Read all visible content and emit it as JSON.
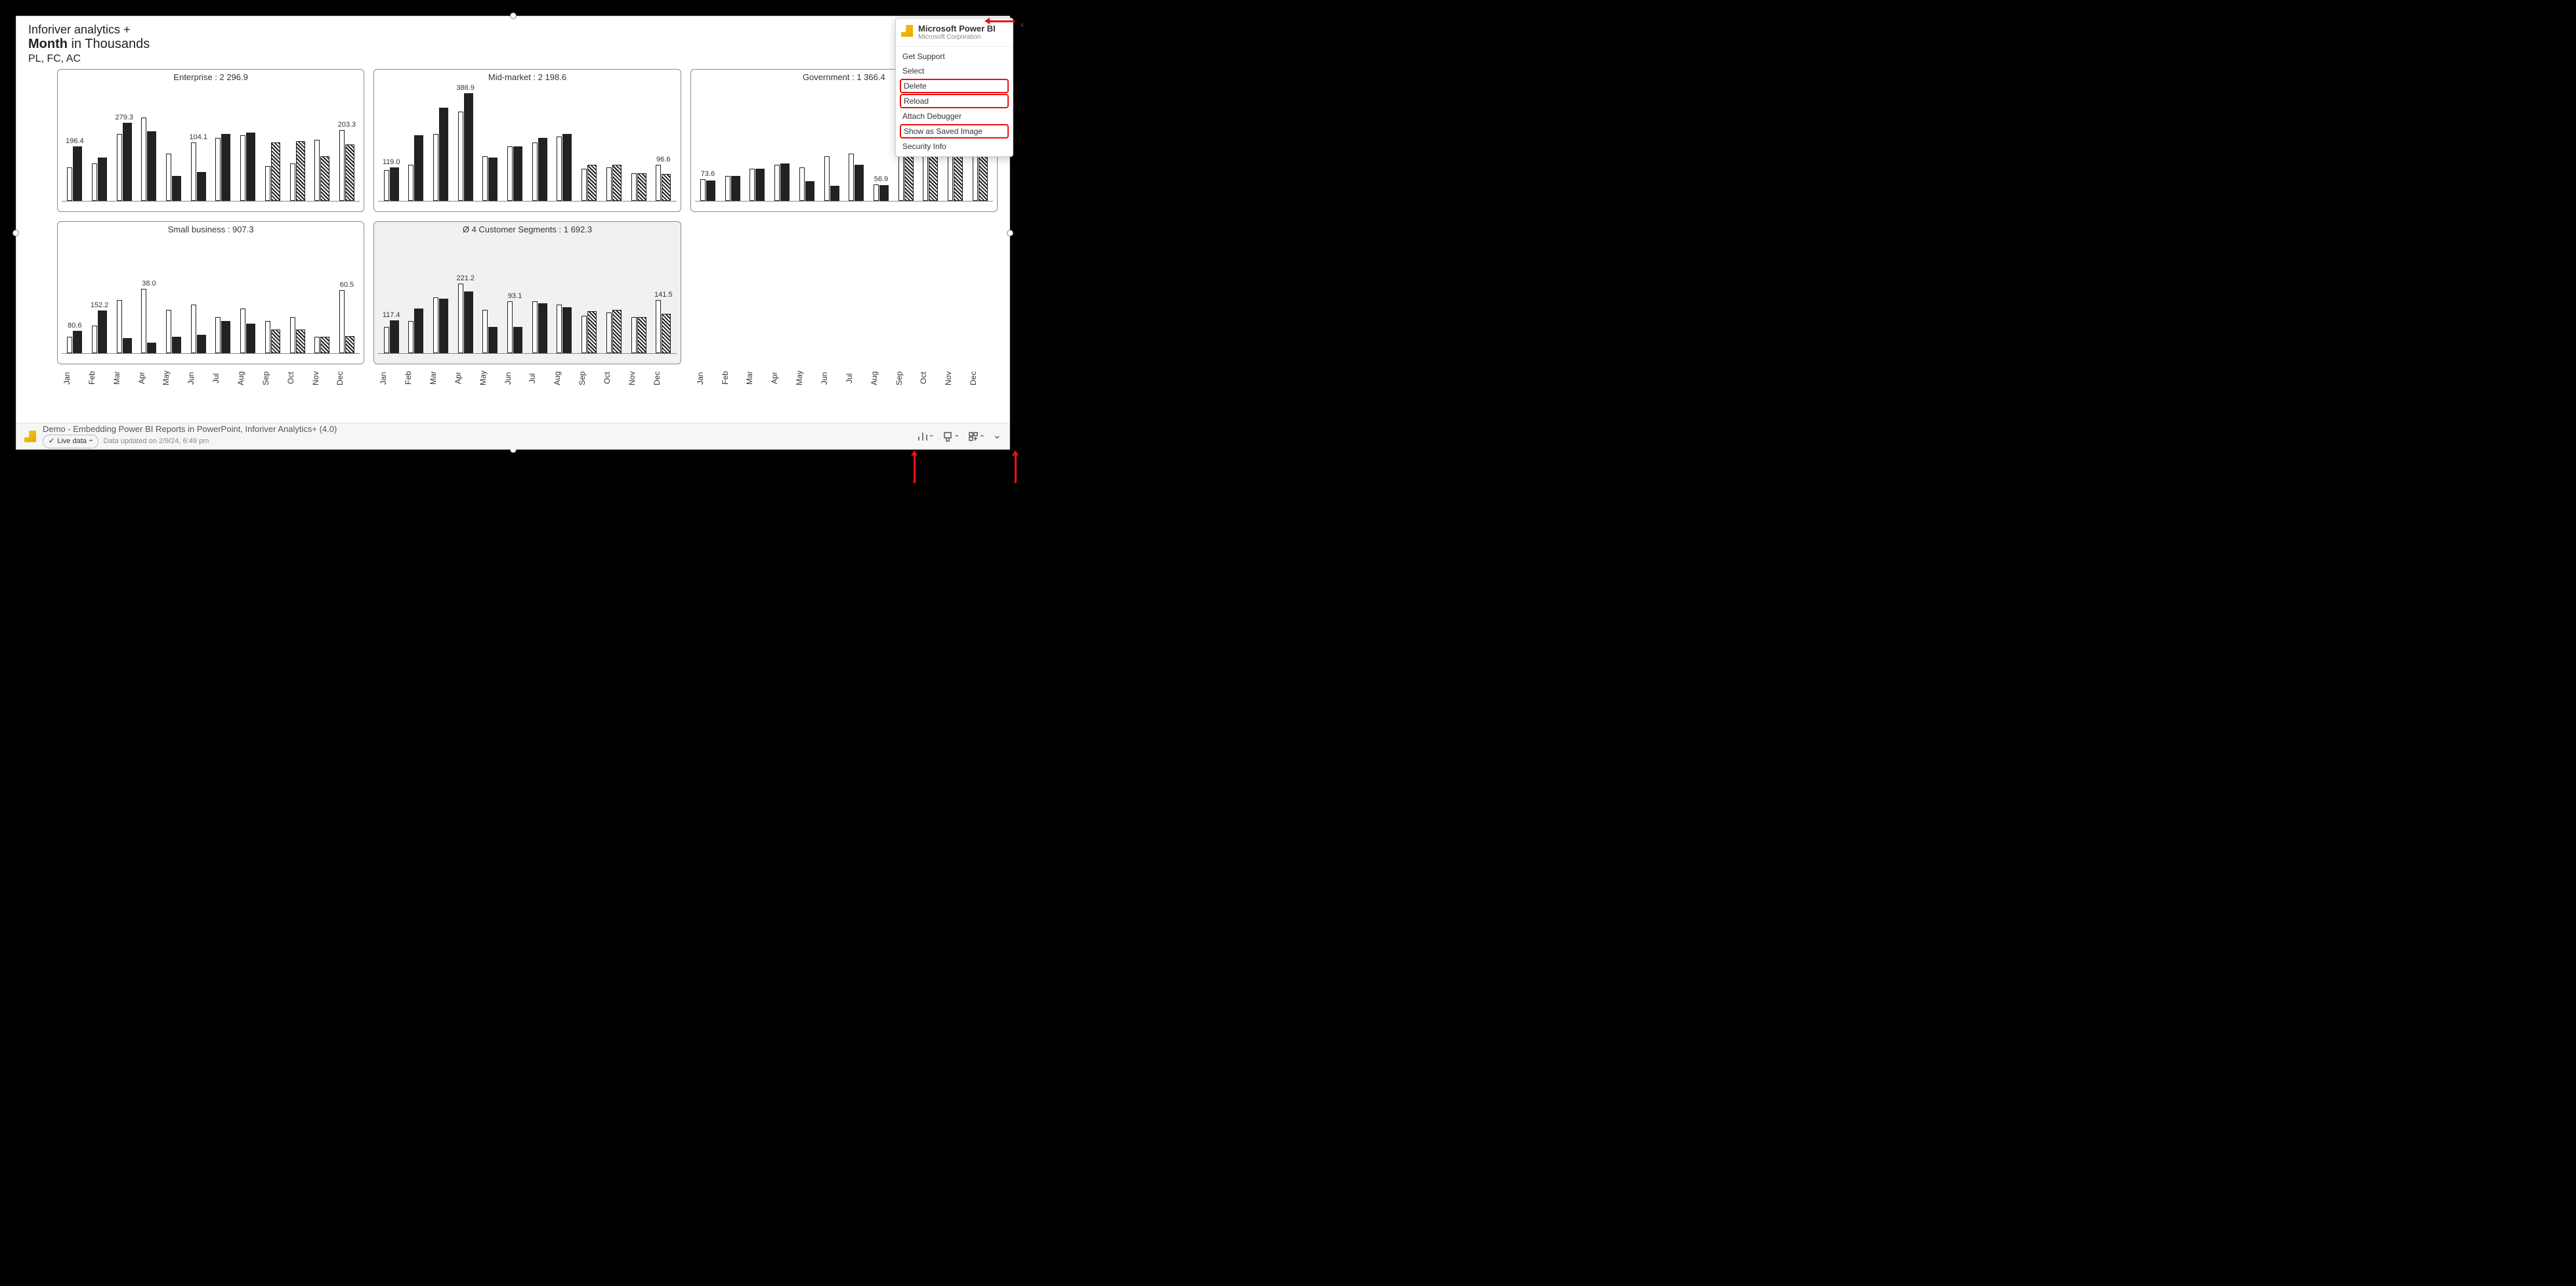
{
  "title": {
    "line1": "Inforiver analytics +",
    "metric": "Month",
    "unit": " in Thousands",
    "scenarios": "PL, FC, AC"
  },
  "months": [
    "Jan",
    "Feb",
    "Mar",
    "Apr",
    "May",
    "Jun",
    "Jul",
    "Aug",
    "Sep",
    "Oct",
    "Nov",
    "Dec"
  ],
  "context_menu": {
    "title": "Microsoft Power BI",
    "subtitle": "Microsoft Corporation",
    "items": [
      {
        "label": "Get Support",
        "boxed": false
      },
      {
        "label": "Select",
        "boxed": false
      },
      {
        "label": "Delete",
        "boxed": true
      },
      {
        "label": "Reload",
        "boxed": true
      },
      {
        "label": "Attach Debugger",
        "boxed": false
      },
      {
        "label": "Show as Saved Image",
        "boxed": true
      },
      {
        "label": "Security Info",
        "boxed": false
      }
    ]
  },
  "footer": {
    "title": "Demo - Embedding Power BI Reports in PowerPoint, Inforiver Analytics+ (4.0)",
    "live": "Live data",
    "updated": "Data updated on 2/9/24, 6:49 pm"
  },
  "chart_data": [
    {
      "type": "bar",
      "title": "Enterprise :  2 296.9",
      "categories": [
        "Jan",
        "Feb",
        "Mar",
        "Apr",
        "May",
        "Jun",
        "Jul",
        "Aug",
        "Sep",
        "Oct",
        "Nov",
        "Dec"
      ],
      "ylim": [
        0,
        400
      ],
      "series": [
        {
          "name": "PL",
          "style": "outline",
          "values": [
            120,
            135,
            240,
            300,
            170,
            210,
            225,
            235,
            125,
            135,
            220,
            255
          ]
        },
        {
          "name": "AC",
          "style": "solid",
          "values": [
            196.4,
            155,
            279.3,
            250,
            90,
            104.1,
            240,
            245,
            210,
            215,
            160,
            203.3
          ]
        },
        {
          "name": "FC",
          "style": "hatch",
          "values": [
            null,
            null,
            null,
            null,
            null,
            null,
            null,
            null,
            210,
            215,
            160,
            203.3
          ]
        }
      ],
      "data_labels": {
        "0": "196.4",
        "2": "279.3",
        "5": "104.1",
        "11": "203.3"
      }
    },
    {
      "type": "bar",
      "title": "Mid-market :  2 198.6",
      "categories": [
        "Jan",
        "Feb",
        "Mar",
        "Apr",
        "May",
        "Jun",
        "Jul",
        "Aug",
        "Sep",
        "Oct",
        "Nov",
        "Dec"
      ],
      "ylim": [
        0,
        400
      ],
      "series": [
        {
          "name": "PL",
          "style": "outline",
          "values": [
            110,
            130,
            240,
            320,
            160,
            195,
            210,
            230,
            115,
            120,
            100,
            130
          ]
        },
        {
          "name": "AC",
          "style": "solid",
          "values": [
            119.0,
            235,
            335,
            386.9,
            155,
            195,
            225,
            240,
            130,
            130,
            100,
            96.6
          ]
        },
        {
          "name": "FC",
          "style": "hatch",
          "values": [
            null,
            null,
            null,
            null,
            null,
            null,
            null,
            null,
            130,
            130,
            100,
            96.6
          ]
        }
      ],
      "data_labels": {
        "0": "119.0",
        "3": "386.9",
        "11": "96.6"
      }
    },
    {
      "type": "bar",
      "title": "Government :  1 366.4",
      "categories": [
        "Jan",
        "Feb",
        "Mar",
        "Apr",
        "May",
        "Jun",
        "Jul",
        "Aug",
        "Sep",
        "Oct",
        "Nov",
        "Dec"
      ],
      "ylim": [
        0,
        400
      ],
      "series": [
        {
          "name": "PL",
          "style": "outline",
          "values": [
            78,
            90,
            115,
            130,
            120,
            160,
            170,
            60,
            180,
            190,
            210,
            225
          ]
        },
        {
          "name": "AC",
          "style": "solid",
          "values": [
            73.6,
            90,
            115,
            135,
            70,
            55,
            130,
            56.9,
            180,
            190,
            205,
            220
          ]
        },
        {
          "name": "FC",
          "style": "hatch",
          "values": [
            null,
            null,
            null,
            null,
            null,
            null,
            null,
            null,
            180,
            190,
            205,
            220
          ]
        }
      ],
      "data_labels": {
        "0": "73.6",
        "7": "56.9"
      }
    },
    {
      "type": "bar",
      "title": "Small business :  907.3",
      "categories": [
        "Jan",
        "Feb",
        "Mar",
        "Apr",
        "May",
        "Jun",
        "Jul",
        "Aug",
        "Sep",
        "Oct",
        "Nov",
        "Dec"
      ],
      "ylim": [
        0,
        400
      ],
      "series": [
        {
          "name": "PL",
          "style": "outline",
          "values": [
            60,
            100,
            190,
            230,
            155,
            175,
            130,
            160,
            115,
            130,
            60,
            225
          ]
        },
        {
          "name": "AC",
          "style": "solid",
          "values": [
            80.6,
            152.2,
            55,
            38.0,
            60,
            65,
            115,
            105,
            85,
            85,
            60,
            60.5
          ]
        },
        {
          "name": "FC",
          "style": "hatch",
          "values": [
            null,
            null,
            null,
            null,
            null,
            null,
            null,
            null,
            85,
            85,
            60,
            60.5
          ]
        }
      ],
      "data_labels": {
        "0": "80.6",
        "1": "152.2",
        "3": "38.0",
        "11": "60.5"
      }
    },
    {
      "type": "bar",
      "title": "Ø 4 Customer Segments :  1 692.3",
      "summary": true,
      "categories": [
        "Jan",
        "Feb",
        "Mar",
        "Apr",
        "May",
        "Jun",
        "Jul",
        "Aug",
        "Sep",
        "Oct",
        "Nov",
        "Dec"
      ],
      "ylim": [
        0,
        400
      ],
      "series": [
        {
          "name": "PL",
          "style": "outline",
          "values": [
            95,
            115,
            200,
            250,
            155,
            185,
            185,
            175,
            135,
            145,
            130,
            190
          ]
        },
        {
          "name": "AC",
          "style": "solid",
          "values": [
            117.4,
            160,
            195,
            221.2,
            95,
            93.1,
            180,
            165,
            150,
            155,
            130,
            141.5
          ]
        },
        {
          "name": "FC",
          "style": "hatch",
          "values": [
            null,
            null,
            null,
            null,
            null,
            null,
            null,
            null,
            150,
            155,
            130,
            141.5
          ]
        }
      ],
      "data_labels": {
        "0": "117.4",
        "3": "221.2",
        "5": "93.1",
        "11": "141.5"
      }
    }
  ]
}
